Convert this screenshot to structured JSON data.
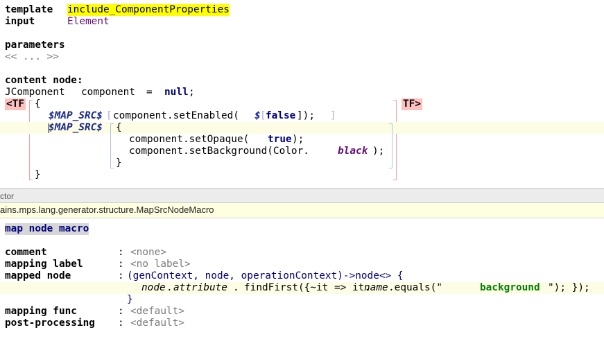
{
  "template_editor": {
    "template_keyword": "template",
    "template_name": "include_ComponentProperties",
    "input_keyword": "input",
    "input_type": "Element",
    "parameters_keyword": "parameters",
    "parameters_placeholder": "<< ... >>",
    "content_node_keyword": "content node:",
    "decl_type": "JComponent",
    "decl_var": "component",
    "decl_eq": "=",
    "decl_null": "null",
    "decl_semi": ";",
    "tf_open": "<TF",
    "tf_close": "TF>",
    "brace_open": "{",
    "brace_close": "}",
    "macro_label": "$MAP_SRC$",
    "line1_call": "component.setEnabled(",
    "line1_dollar": "$",
    "line1_false": "false",
    "line1_end": "]);",
    "line2_brace": "{",
    "setopaque_call": "component.setOpaque(",
    "setopaque_true": "true",
    "setopaque_end": ");",
    "setbg_call": "component.setBackground(Color.",
    "setbg_black": "black",
    "setbg_end": ");",
    "inner_close": "}"
  },
  "inspector": {
    "title": "ctor",
    "breadcrumb": "ains.mps.lang.generator.structure.MapSrcNodeMacro",
    "concept_title": "map node macro",
    "colon": ":",
    "props": {
      "comment_label": "comment",
      "comment_value": "<none>",
      "mapping_label_label": "mapping label",
      "mapping_label_value": "<no label>",
      "mapped_node_label": "mapped node",
      "mapped_node_sig": "(genContext, node, operationContext)->node<> {",
      "mapped_node_body_node": "node",
      "mapped_node_body_attr": "attribute",
      "mapped_node_body_find": "findFirst({~it => it.",
      "mapped_node_body_name": "name",
      "mapped_node_body_equals": ".equals(\"",
      "mapped_node_body_str": "background",
      "mapped_node_body_end": "\"); });",
      "mapped_node_close": "}",
      "mapping_func_label": "mapping func",
      "mapping_func_value": "<default>",
      "post_processing_label": "post-processing",
      "post_processing_value": "<default>"
    }
  }
}
